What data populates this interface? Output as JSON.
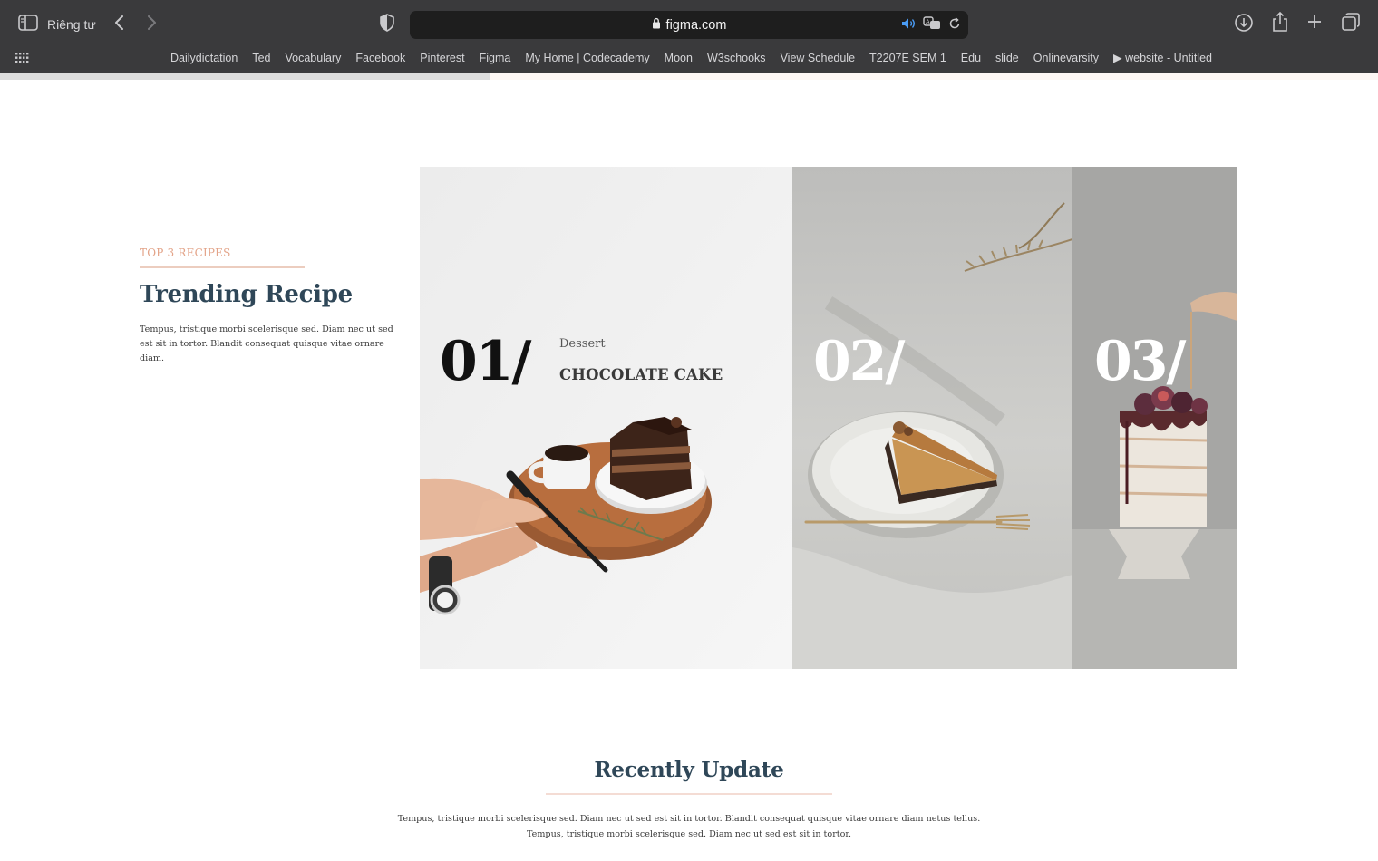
{
  "browser": {
    "sidebar_label": "Riêng tư",
    "url": "figma.com",
    "bookmarks": [
      "Dailydictation",
      "Ted",
      "Vocabulary",
      "Facebook",
      "Pinterest",
      "Figma",
      "My Home | Codecademy",
      "Moon",
      "W3schooks",
      "View Schedule",
      "T2207E SEM 1",
      "Edu",
      "slide",
      "Onlinevarsity",
      "▶ website - Untitled"
    ],
    "load_progress": 0.356
  },
  "trending": {
    "eyebrow": "TOP 3 RECIPES",
    "title": "Trending Recipe",
    "description": "Tempus, tristique morbi scelerisque sed. Diam nec ut sed est sit in tortor. Blandit consequat quisque vitae ornare diam.",
    "items": [
      {
        "number": "01/",
        "category": "Dessert",
        "name": "CHOCOLATE CAKE"
      },
      {
        "number": "02/"
      },
      {
        "number": "03/"
      }
    ]
  },
  "recent": {
    "title": "Recently Update",
    "description_line1": "Tempus, tristique morbi scelerisque sed. Diam nec ut sed est sit in tortor. Blandit consequat quisque vitae ornare diam netus tellus.",
    "description_line2": "Tempus, tristique morbi scelerisque sed. Diam nec ut sed est sit in tortor."
  },
  "colors": {
    "chrome": "#3a3a3c",
    "accent": "#e3a489",
    "heading": "#2f4758"
  },
  "icons": [
    "sidebar-icon",
    "chevron-left-icon",
    "chevron-right-icon",
    "shield-icon",
    "lock-icon",
    "speaker-icon",
    "translate-icon",
    "reload-icon",
    "download-icon",
    "share-icon",
    "plus-icon",
    "tabs-icon",
    "grid-icon"
  ]
}
